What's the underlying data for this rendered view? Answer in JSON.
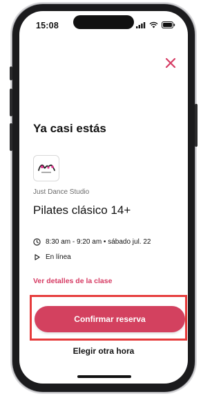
{
  "status_bar": {
    "time": "15:08",
    "icons": [
      "signal-icon",
      "wifi-icon",
      "battery-icon"
    ]
  },
  "header": {
    "close_icon": "close-icon"
  },
  "booking": {
    "title": "Ya casi estás",
    "studio_name": "Just Dance Studio",
    "class_name": "Pilates clásico 14+",
    "schedule": "8:30 am - 9:20 am • sábado jul. 22",
    "mode": "En línea",
    "details_link": "Ver detalles de la clase",
    "confirm_button": "Confirmar reserva",
    "other_time_button": "Elegir otra hora"
  },
  "colors": {
    "accent": "#d3415f",
    "link": "#d63b63",
    "highlight_box": "#e63b3b"
  }
}
